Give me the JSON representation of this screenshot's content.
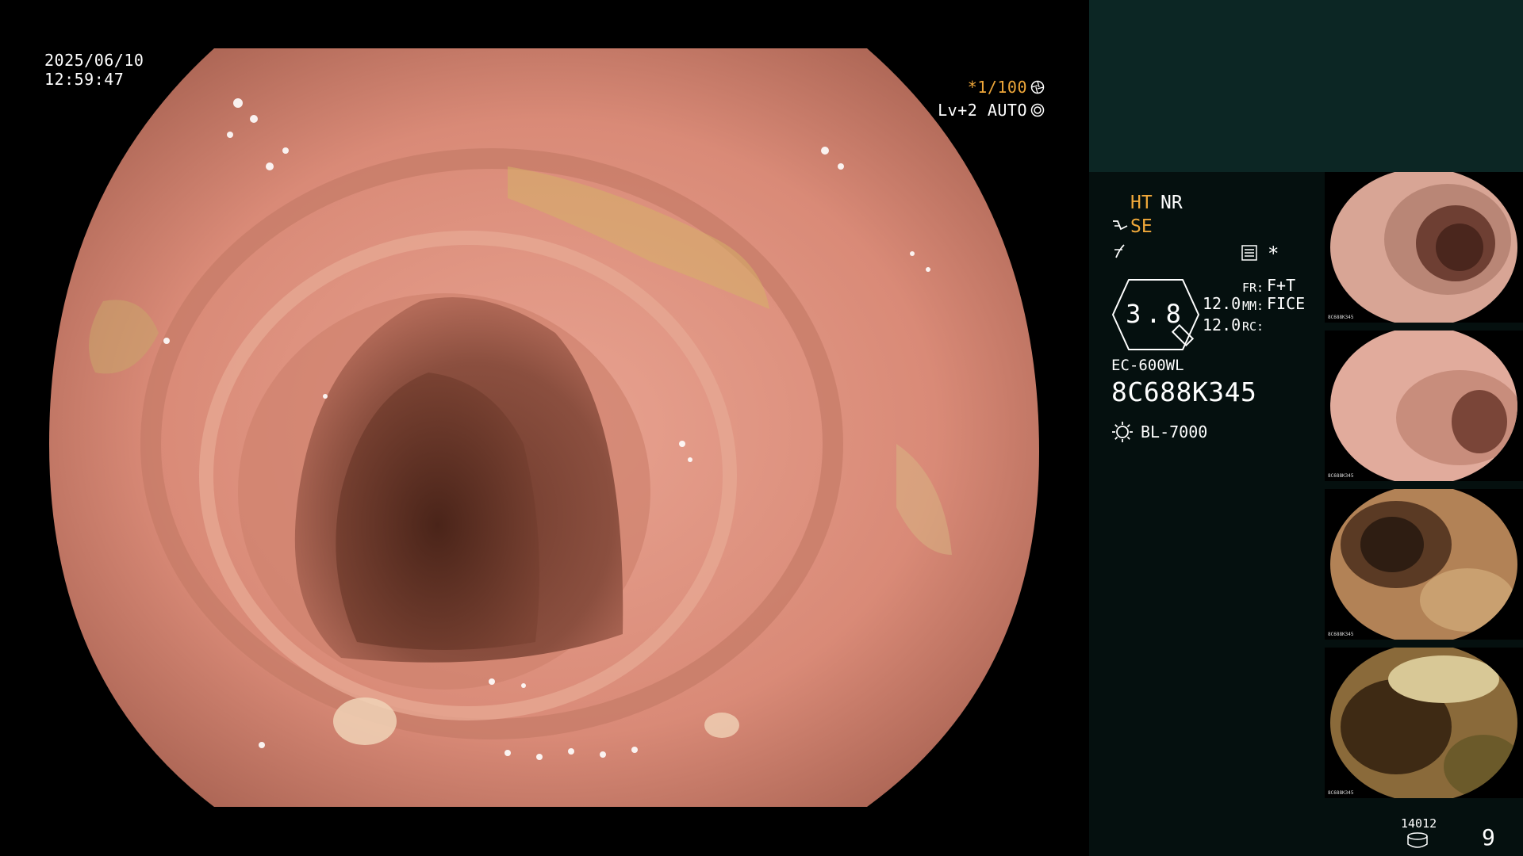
{
  "main_view": {
    "date": "2025/06/10",
    "time": "12:59:47",
    "shutter": "*1/100",
    "iris": "Lv+2 AUTO"
  },
  "panel": {
    "ht_label": "HT",
    "nr_label": "NR",
    "se_label": "SE",
    "star": "*",
    "zoom": "3.8",
    "num1": "12.0",
    "num2": "12.0",
    "fr_key": "FR:",
    "fr_val": "F+T",
    "mm_key": "MM:",
    "mm_val": "FICE",
    "rc_key": "RC:",
    "scope_model": "EC-600WL",
    "scope_serial": "8C688K345",
    "light_source": "BL-7000",
    "image_count": "14012",
    "capture_count": "9"
  },
  "thumbnails": [
    {
      "serial": "8C688K345",
      "tone": "pink"
    },
    {
      "serial": "8C688K345",
      "tone": "pink"
    },
    {
      "serial": "8C688K345",
      "tone": "brown"
    },
    {
      "serial": "8C688K345",
      "tone": "dark"
    }
  ],
  "colors": {
    "accent_orange": "#f0a83a",
    "panel_top": "#0c2624",
    "panel_bg": "#05100f"
  },
  "icons": [
    "shutter-icon",
    "iris-icon",
    "structure-enhance-icon",
    "color-enhance-icon",
    "menu-icon",
    "zoom-badge-icon",
    "light-source-icon",
    "database-icon"
  ]
}
